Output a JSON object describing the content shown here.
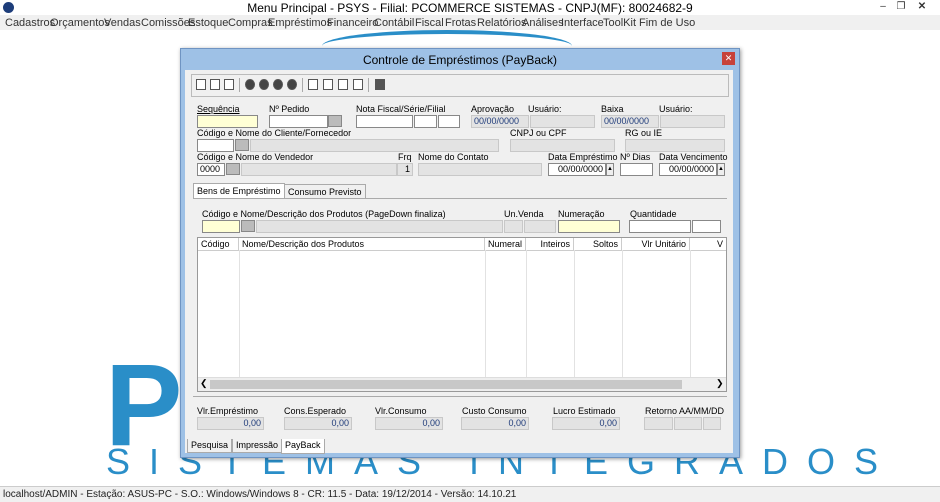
{
  "window": {
    "title": "Menu Principal - PSYS - Filial: PCOMMERCE SISTEMAS - CNPJ(MF): 80024682-9"
  },
  "menu": [
    "Cadastros",
    "Orçamentos",
    "Vendas",
    "Comissões",
    "Estoque",
    "Compras",
    "Empréstimos",
    "Financeiro",
    "Contábil",
    "Fiscal",
    "Frotas",
    "Relatórios",
    "Análises",
    "Interface",
    "ToolKit",
    "Fim de Uso"
  ],
  "logo": {
    "letters": "P S",
    "subtitle": "SISTEMAS INTEGRADOS"
  },
  "status": "localhost/ADMIN - Estação: ASUS-PC - S.O.: Windows/Windows 8 - CR: 11.5  - Data: 19/12/2014 - Versão: 14.10.21",
  "dialog": {
    "title": "Controle de Empréstimos (PayBack)",
    "labels": {
      "sequencia": "Sequência",
      "pedido": "Nº Pedido",
      "nota": "Nota Fiscal/Série/Filial",
      "aprovacao": "Aprovação",
      "usuario1": "Usuário:",
      "baixa": "Baixa",
      "usuario2": "Usuário:",
      "cliente": "Código e Nome do Cliente/Fornecedor",
      "cnpj": "CNPJ ou CPF",
      "rg": "RG ou IE",
      "vendedor": "Código e Nome do Vendedor",
      "frq": "Frq",
      "contato": "Nome do Contato",
      "data_emp": "Data Empréstimo",
      "dias": "Nº Dias",
      "data_venc": "Data Vencimento"
    },
    "values": {
      "aprovacao": "00/00/0000",
      "baixa": "00/00/0000",
      "vendedor_code": "0000",
      "frq": "1",
      "data_emp": "00/00/0000",
      "data_venc": "00/00/0000"
    },
    "tabs": [
      "Bens de Empréstimo",
      "Consumo Previsto"
    ],
    "product": {
      "label": "Código e Nome/Descrição dos Produtos  (PageDown finaliza)",
      "unvenda": "Un.Venda",
      "numeracao": "Numeração",
      "quantidade": "Quantidade"
    },
    "grid_columns": [
      "Código",
      "Nome/Descrição dos Produtos",
      "Numeral",
      "Inteiros",
      "Soltos",
      "Vlr Unitário",
      "V"
    ],
    "totals": {
      "labels": [
        "Vlr.Empréstimo",
        "Cons.Esperado",
        "Vlr.Consumo",
        "Custo Consumo",
        "Lucro Estimado",
        "Retorno AA/MM/DD"
      ],
      "values": [
        "0,00",
        "0,00",
        "0,00",
        "0,00",
        "0,00"
      ]
    },
    "bottom_tabs": [
      "Pesquisa",
      "Impressão",
      "PayBack"
    ]
  }
}
